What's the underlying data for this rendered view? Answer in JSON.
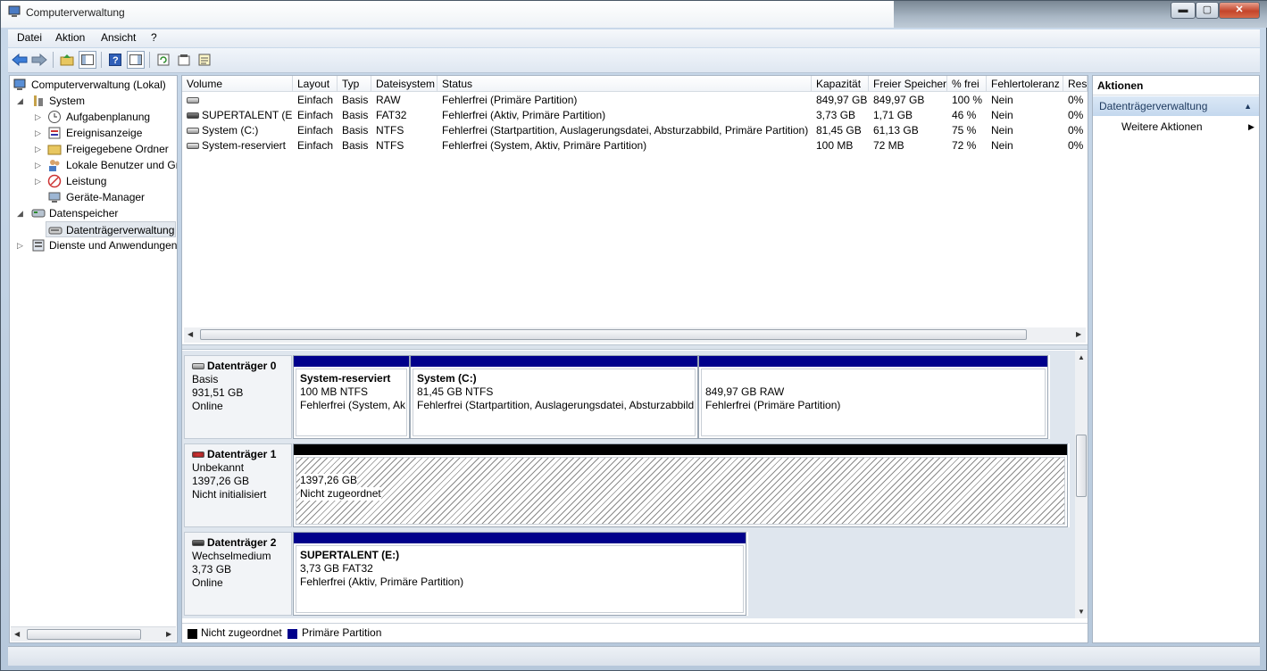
{
  "window": {
    "title": "Computerverwaltung",
    "buttons": {
      "minimize": "▬",
      "maximize": "▢",
      "close": "✕"
    }
  },
  "menu": [
    "Datei",
    "Aktion",
    "Ansicht",
    "?"
  ],
  "toolbar": {
    "icons": [
      "back-icon",
      "forward-icon",
      "up-folder-icon",
      "show-hide-tree-icon",
      "help-icon",
      "show-hide-action-pane-icon",
      "refresh-icon",
      "properties-icon",
      "export-list-icon"
    ]
  },
  "tree": {
    "root": "Computerverwaltung (Lokal)",
    "system": "System",
    "aufgaben": "Aufgabenplanung",
    "ereignis": "Ereignisanzeige",
    "freigabe": "Freigegebene Ordner",
    "benutzer": "Lokale Benutzer und Gr",
    "leistung": "Leistung",
    "geraete": "Geräte-Manager",
    "datenspeicher": "Datenspeicher",
    "datentraeger": "Datenträgerverwaltung",
    "dienste": "Dienste und Anwendungen"
  },
  "volume_table": {
    "headers": [
      "Volume",
      "Layout",
      "Typ",
      "Dateisystem",
      "Status",
      "Kapazität",
      "Freier Speicher",
      "% frei",
      "Fehlertoleranz",
      "Rest"
    ],
    "rows": [
      [
        "",
        "Einfach",
        "Basis",
        "RAW",
        "Fehlerfrei (Primäre Partition)",
        "849,97 GB",
        "849,97 GB",
        "100 %",
        "Nein",
        "0%"
      ],
      [
        "SUPERTALENT (E:)",
        "Einfach",
        "Basis",
        "FAT32",
        "Fehlerfrei (Aktiv, Primäre Partition)",
        "3,73 GB",
        "1,71 GB",
        "46 %",
        "Nein",
        "0%"
      ],
      [
        "System (C:)",
        "Einfach",
        "Basis",
        "NTFS",
        "Fehlerfrei (Startpartition, Auslagerungsdatei, Absturzabbild, Primäre Partition)",
        "81,45 GB",
        "61,13 GB",
        "75 %",
        "Nein",
        "0%"
      ],
      [
        "System-reserviert",
        "Einfach",
        "Basis",
        "NTFS",
        "Fehlerfrei (System, Aktiv, Primäre Partition)",
        "100 MB",
        "72 MB",
        "72 %",
        "Nein",
        "0%"
      ]
    ]
  },
  "disks": {
    "d0": {
      "name": "Datenträger 0",
      "type": "Basis",
      "size": "931,51 GB",
      "state": "Online",
      "p1": {
        "title": "System-reserviert",
        "info": "100 MB NTFS",
        "status": "Fehlerfrei (System, Ak"
      },
      "p2": {
        "title": "System  (C:)",
        "info": "81,45 GB NTFS",
        "status": "Fehlerfrei (Startpartition, Auslagerungsdatei, Absturzabbild"
      },
      "p3": {
        "title": "",
        "info": "849,97 GB RAW",
        "status": "Fehlerfrei (Primäre Partition)"
      }
    },
    "d1": {
      "name": "Datenträger 1",
      "type": "Unbekannt",
      "size": "1397,26 GB",
      "state": "Nicht initialisiert",
      "p1": {
        "info": "1397,26 GB",
        "status": "Nicht zugeordnet"
      }
    },
    "d2": {
      "name": "Datenträger 2",
      "type": "Wechselmedium",
      "size": "3,73 GB",
      "state": "Online",
      "p1": {
        "title": "SUPERTALENT  (E:)",
        "info": "3,73 GB FAT32",
        "status": "Fehlerfrei (Aktiv, Primäre Partition)"
      }
    }
  },
  "legend": {
    "unallocated": {
      "label": "Nicht zugeordnet",
      "color": "#000000"
    },
    "primary": {
      "label": "Primäre Partition",
      "color": "#00008b"
    }
  },
  "actions": {
    "heading": "Aktionen",
    "section": "Datenträgerverwaltung",
    "more": "Weitere Aktionen"
  }
}
